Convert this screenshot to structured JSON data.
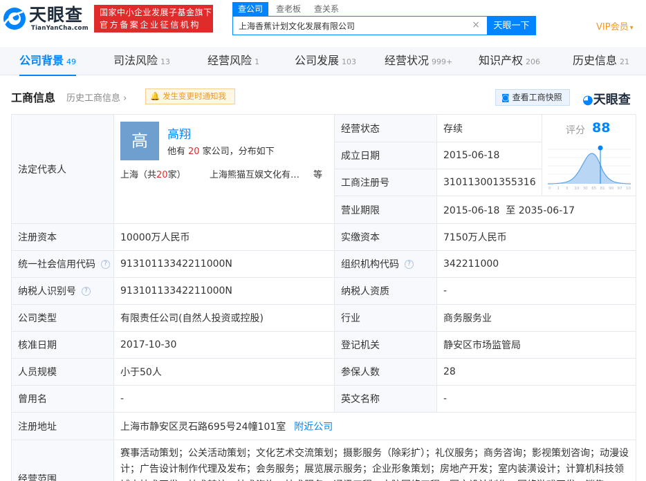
{
  "header": {
    "logo_cn": "天眼查",
    "logo_en": "TianYanCha.com",
    "badge_line1": "国家中小企业发展子基金旗下",
    "badge_line2": "官方备案企业征信机构",
    "search_tabs": [
      "查公司",
      "查老板",
      "查关系"
    ],
    "search_value": "上海香蕉计划文化发展有限公司",
    "search_button": "天眼一下",
    "clear_icon": "×",
    "vip_label": "VIP会员",
    "accent": "#0084ff",
    "badge_color": "#e02b2b",
    "vip_color": "#ef9a24"
  },
  "nav": [
    {
      "label": "公司背景",
      "count": "49"
    },
    {
      "label": "司法风险",
      "count": "13"
    },
    {
      "label": "经营风险",
      "count": "1"
    },
    {
      "label": "公司发展",
      "count": "103"
    },
    {
      "label": "经营状况",
      "count": "999+"
    },
    {
      "label": "知识产权",
      "count": "206"
    },
    {
      "label": "历史信息",
      "count": "21"
    }
  ],
  "section": {
    "title": "工商信息",
    "history_link": "历史工商信息",
    "notify": "发生变更时通知我",
    "snapshot": "查看工商快照",
    "brand": "天眼查"
  },
  "rep": {
    "label": "法定代表人",
    "avatar": "高",
    "name": "高翔",
    "desc_pre": "他有",
    "desc_count": "20",
    "desc_post": "家公司，分布如下",
    "loc_pre": "上海（共",
    "loc_count": "20",
    "loc_post": "家）",
    "company": "上海熊猫互娱文化有限公司",
    "etc": "等"
  },
  "score": {
    "label": "评分",
    "value": "88",
    "axis": [
      "0",
      "1",
      "3",
      "10",
      "30",
      "65",
      "81",
      "90",
      "97",
      "100"
    ]
  },
  "top_right": [
    {
      "label": "经营状态",
      "value": "存续"
    },
    {
      "label": "成立日期",
      "value": "2015-06-18"
    },
    {
      "label": "工商注册号",
      "value": "310113001355316"
    },
    {
      "label": "营业期限",
      "value": "2015-06-18  至 2035-06-17"
    }
  ],
  "rows": {
    "reg_capital": {
      "label": "注册资本",
      "value": "10000万人民币"
    },
    "paid_capital": {
      "label": "实缴资本",
      "value": "7150万人民币"
    },
    "credit_code": {
      "label": "统一社会信用代码",
      "value": "91310113342211000N"
    },
    "org_code": {
      "label": "组织机构代码",
      "value": "342211000"
    },
    "tax_id": {
      "label": "纳税人识别号",
      "value": "91310113342211000N"
    },
    "tax_qual": {
      "label": "纳税人资质",
      "value": "-"
    },
    "company_type": {
      "label": "公司类型",
      "value": "有限责任公司(自然人投资或控股)"
    },
    "industry": {
      "label": "行业",
      "value": "商务服务业"
    },
    "approval_date": {
      "label": "核准日期",
      "value": "2017-10-30"
    },
    "authority": {
      "label": "登记机关",
      "value": "静安区市场监管局"
    },
    "staff": {
      "label": "人员规模",
      "value": "小于50人"
    },
    "insured": {
      "label": "参保人数",
      "value": "28"
    },
    "former_name": {
      "label": "曾用名",
      "value": "-"
    },
    "english_name": {
      "label": "英文名称",
      "value": "-"
    },
    "address": {
      "label": "注册地址",
      "value": "上海市静安区灵石路695号24幢101室",
      "link": "附近公司"
    },
    "scope": {
      "label": "经营范围",
      "value": "赛事活动策划；公关活动策划；文化艺术交流策划；摄影服务（除彩扩）；礼仪服务；商务咨询；影视策划咨询；动漫设计；广告设计制作代理及发布；会务服务；展览展示服务；企业形象策划；房地产开发；室内装潢设计；计算机科技领域内技术开发、技术转让、技术咨询、技术服务；通讯工程；电脑网络工程；图文设计制作；网络游戏开发；销售"
    }
  }
}
